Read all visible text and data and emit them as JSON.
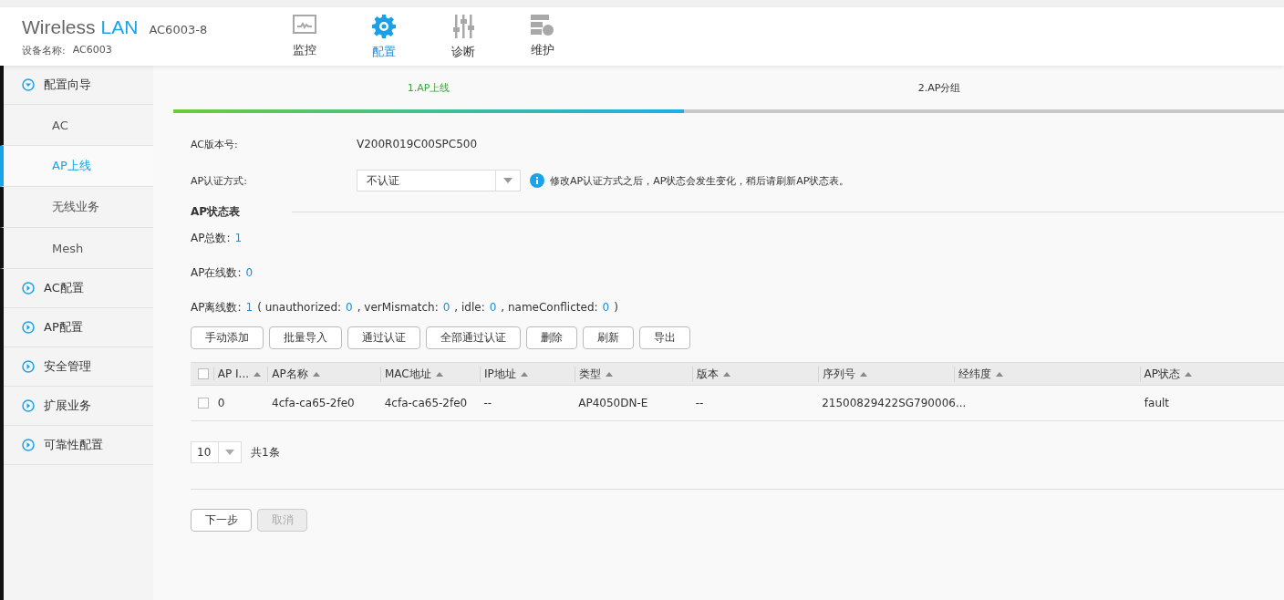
{
  "header": {
    "brand_main": "Wireless",
    "brand_accent": "LAN",
    "model": "AC6003-8",
    "device_label": "设备名称:",
    "device_name": "AC6003"
  },
  "nav": [
    {
      "label": "监控",
      "kind": "monitor",
      "selected": false
    },
    {
      "label": "配置",
      "kind": "config",
      "selected": true
    },
    {
      "label": "诊断",
      "kind": "diagnose",
      "selected": false
    },
    {
      "label": "维护",
      "kind": "maintain",
      "selected": false
    }
  ],
  "sidebar": [
    {
      "label": "配置向导",
      "expanded": true,
      "children": [
        {
          "label": "AC",
          "selected": false
        },
        {
          "label": "AP上线",
          "selected": true
        },
        {
          "label": "无线业务",
          "selected": false
        },
        {
          "label": "Mesh",
          "selected": false
        }
      ]
    },
    {
      "label": "AC配置",
      "expanded": false
    },
    {
      "label": "AP配置",
      "expanded": false
    },
    {
      "label": "安全管理",
      "expanded": false
    },
    {
      "label": "扩展业务",
      "expanded": false
    },
    {
      "label": "可靠性配置",
      "expanded": false
    }
  ],
  "steps": [
    {
      "label": "1.AP上线",
      "selected": true
    },
    {
      "label": "2.AP分组",
      "selected": false
    }
  ],
  "progress": {
    "level": 0.46
  },
  "form": {
    "version_label": "AC版本号:",
    "version_value": "V200R019C00SPC500",
    "auth_label": "AP认证方式:",
    "auth_value": "不认证",
    "info_text": "修改AP认证方式之后，AP状态会发生变化，稍后请刷新AP状态表。"
  },
  "section_title": "AP状态表",
  "stats": [
    [
      {
        "text": "AP总数:",
        "kind": "label"
      },
      {
        "text": "1",
        "kind": "value"
      }
    ],
    [
      {
        "text": "AP在线数:",
        "kind": "label"
      },
      {
        "text": "0",
        "kind": "value"
      }
    ],
    [
      {
        "text": "AP离线数:",
        "kind": "label"
      },
      {
        "text": "1",
        "kind": "value"
      },
      {
        "text": "( unauthorized:",
        "kind": "label"
      },
      {
        "text": "0",
        "kind": "value"
      },
      {
        "text": ", verMismatch:",
        "kind": "label"
      },
      {
        "text": "0",
        "kind": "value"
      },
      {
        "text": ", idle:",
        "kind": "label"
      },
      {
        "text": "0",
        "kind": "value"
      },
      {
        "text": ", nameConflicted:",
        "kind": "label"
      },
      {
        "text": "0",
        "kind": "value"
      },
      {
        "text": ")",
        "kind": "label"
      }
    ]
  ],
  "buttons": [
    "手动添加",
    "批量导入",
    "通过认证",
    "全部通过认证",
    "删除",
    "刷新",
    "导出"
  ],
  "table": {
    "all_checked": false,
    "columns": [
      "AP I...",
      "AP名称",
      "MAC地址",
      "IP地址",
      "类型",
      "版本",
      "序列号",
      "经纬度",
      "AP状态"
    ],
    "rows": [
      {
        "checked": false,
        "cells": [
          "0",
          "4cfa-ca65-2fe0",
          "4cfa-ca65-2fe0",
          "--",
          "AP4050DN-E",
          "--",
          "21500829422SG790006...",
          "",
          "fault"
        ]
      }
    ]
  },
  "pagination": {
    "page_size": "10",
    "total": "共1条"
  },
  "footer_buttons": [
    {
      "label": "下一步",
      "disabled": false
    },
    {
      "label": "取消",
      "disabled": true
    }
  ]
}
